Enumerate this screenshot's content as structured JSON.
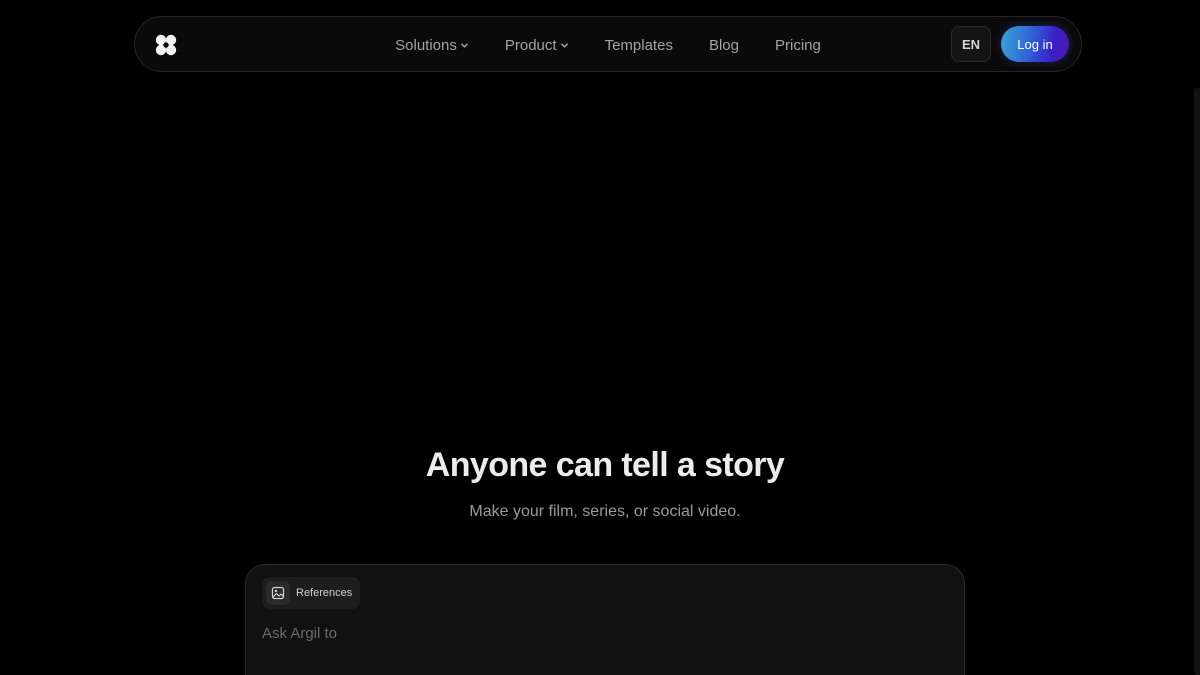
{
  "nav": {
    "logo": "argil-logo-icon",
    "items": [
      {
        "label": "Solutions",
        "has_dropdown": true
      },
      {
        "label": "Product",
        "has_dropdown": true
      },
      {
        "label": "Templates",
        "has_dropdown": false
      },
      {
        "label": "Blog",
        "has_dropdown": false
      },
      {
        "label": "Pricing",
        "has_dropdown": false
      }
    ],
    "language": "EN",
    "login_label": "Log in"
  },
  "hero": {
    "title": "Anyone can tell a story",
    "subtitle": "Make your film, series, or social video."
  },
  "prompt": {
    "references_label": "References",
    "placeholder": "Ask Argil to"
  },
  "colors": {
    "background": "#000000",
    "login_gradient_start": "#3aa6d8",
    "login_gradient_end": "#4c1aa8"
  }
}
